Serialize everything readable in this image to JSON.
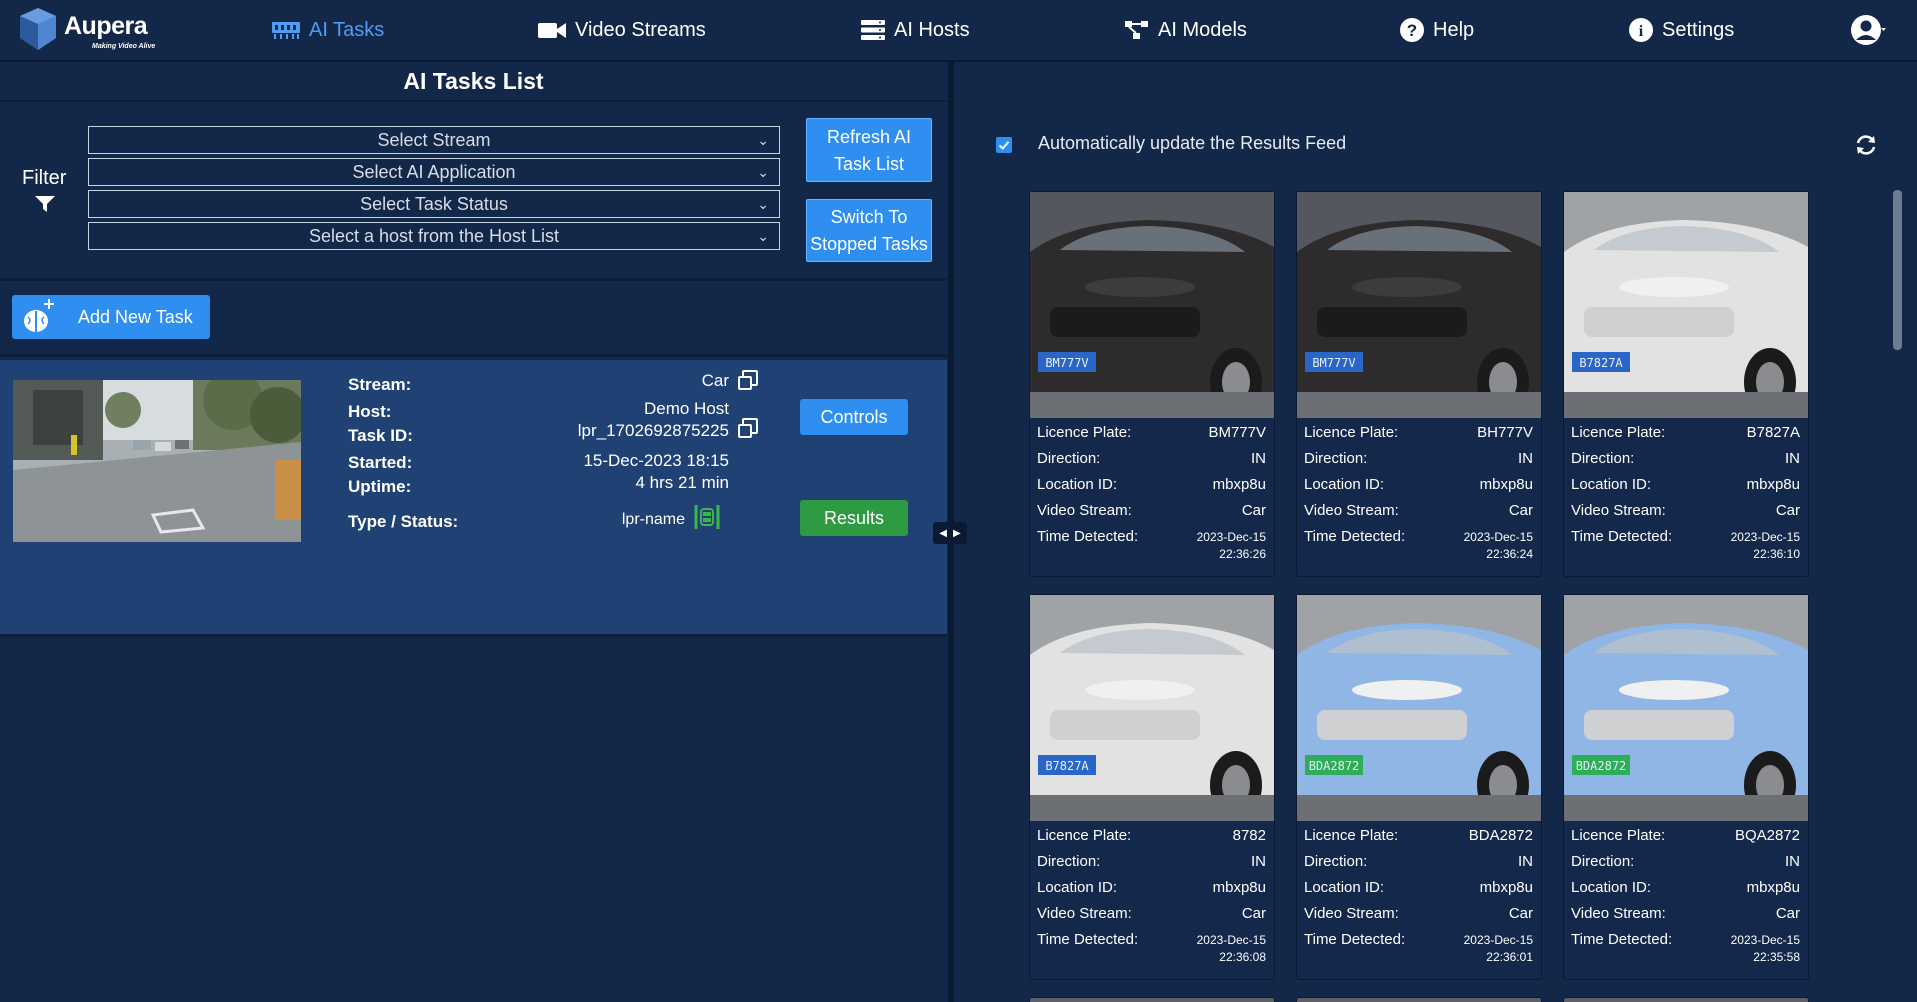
{
  "nav": {
    "logo_text": "Aupera",
    "logo_tagline": "Making Video Alive",
    "items": [
      {
        "label": "AI Tasks",
        "icon": "tasks-icon"
      },
      {
        "label": "Video Streams",
        "icon": "video-camera-icon"
      },
      {
        "label": "AI Hosts",
        "icon": "server-icon"
      },
      {
        "label": "AI Models",
        "icon": "network-icon"
      },
      {
        "label": "Help",
        "icon": "help-icon"
      },
      {
        "label": "Settings",
        "icon": "info-icon"
      }
    ],
    "active": "AI Tasks"
  },
  "left": {
    "title": "AI Tasks List",
    "filter_label": "Filter",
    "selects": {
      "stream": "Select Stream",
      "app": "Select AI Application",
      "status": "Select Task Status",
      "host": "Select a host from the Host List"
    },
    "refresh_btn": [
      "Refresh AI",
      "Task List"
    ],
    "switch_btn": [
      "Switch To",
      "Stopped Tasks"
    ],
    "add_task": "Add New Task",
    "task": {
      "stream_label": "Stream:",
      "stream": "Car",
      "host_label": "Host:",
      "host": "Demo Host",
      "task_id_label": "Task ID:",
      "task_id": "lpr_1702692875225",
      "started_label": "Started:",
      "started": "15-Dec-2023 18:15",
      "uptime_label": "Uptime:",
      "uptime": "4 hrs 21 min",
      "type_label": "Type / Status:",
      "type": "lpr-name",
      "controls_btn": "Controls",
      "results_btn": "Results"
    }
  },
  "right": {
    "auto_update_label": "Automatically update the Results Feed",
    "auto_update_checked": true,
    "field_labels": {
      "plate": "Licence Plate:",
      "direction": "Direction:",
      "location": "Location ID:",
      "stream": "Video Stream:",
      "time": "Time Detected:"
    },
    "results": [
      {
        "plate": "BM777V",
        "direction": "IN",
        "location": "mbxp8u",
        "stream": "Car",
        "date": "2023-Dec-15",
        "time": "22:36:26",
        "car_color": "#2e2b2c",
        "plate_text": "BM777V"
      },
      {
        "plate": "BH777V",
        "direction": "IN",
        "location": "mbxp8u",
        "stream": "Car",
        "date": "2023-Dec-15",
        "time": "22:36:24",
        "car_color": "#2e2b2c",
        "plate_text": "BM777V"
      },
      {
        "plate": "B7827A",
        "direction": "IN",
        "location": "mbxp8u",
        "stream": "Car",
        "date": "2023-Dec-15",
        "time": "22:36:10",
        "car_color": "#e2e2e2",
        "plate_text": "B7827A"
      },
      {
        "plate": "8782",
        "direction": "IN",
        "location": "mbxp8u",
        "stream": "Car",
        "date": "2023-Dec-15",
        "time": "22:36:08",
        "car_color": "#e2e2e2",
        "plate_text": "B7827A"
      },
      {
        "plate": "BDA2872",
        "direction": "IN",
        "location": "mbxp8u",
        "stream": "Car",
        "date": "2023-Dec-15",
        "time": "22:36:01",
        "car_color": "#8fb6e4",
        "plate_text": "BDA2872"
      },
      {
        "plate": "BQA2872",
        "direction": "IN",
        "location": "mbxp8u",
        "stream": "Car",
        "date": "2023-Dec-15",
        "time": "22:35:58",
        "car_color": "#8fb6e4",
        "plate_text": "BDA2872"
      }
    ]
  },
  "colors": {
    "background": "#132848",
    "card": "#1f4173",
    "accent": "#2e8ff0",
    "active_nav": "#4f9cf5",
    "success": "#2e9b43"
  }
}
